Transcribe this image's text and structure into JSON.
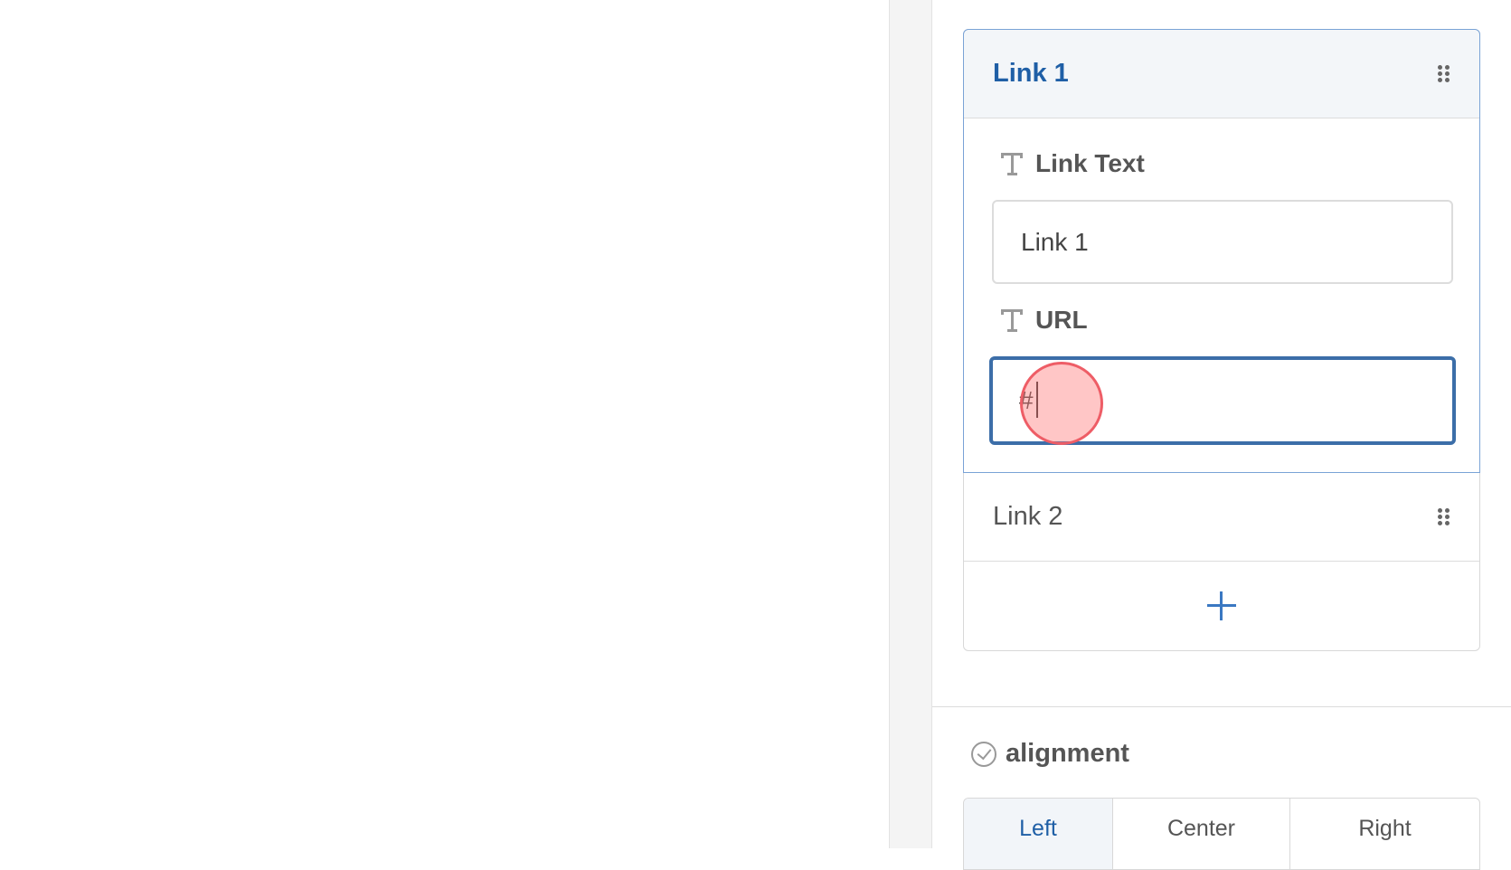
{
  "links_array": {
    "items": [
      {
        "title": "Link 1",
        "expanded": true,
        "fields": {
          "link_text": {
            "label": "Link Text",
            "value": "Link 1"
          },
          "url": {
            "label": "URL",
            "value": "#"
          }
        }
      },
      {
        "title": "Link 2",
        "expanded": false
      }
    ],
    "add_icon": "plus-icon"
  },
  "alignment": {
    "label": "alignment",
    "icon": "check-circle-icon",
    "options": [
      "Left",
      "Center",
      "Right"
    ],
    "selected": "Left"
  },
  "colors": {
    "accent": "#1f5fa6",
    "focus_border": "#3c6ea8",
    "click_marker": "#ee5d66"
  }
}
